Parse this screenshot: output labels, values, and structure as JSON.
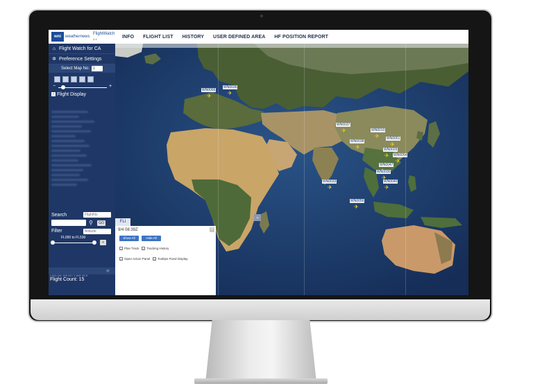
{
  "topbar": {
    "logo_text": "wni",
    "brand": "weathernews",
    "product": "FlightWatch",
    "version": "4.4",
    "nav": [
      "INFO",
      "FLIGHT LIST",
      "HISTORY",
      "USER DEFINED AREA",
      "HF POSITION REPORT"
    ]
  },
  "sidebar": {
    "flight_watch_label": "Flight Watch for CA",
    "preference_label": "Preference Settings",
    "select_map_label": "Select Map No:",
    "select_map_value": "1",
    "flight_display_label": "Flight Display",
    "search_label": "Search",
    "search_type": "FlightNo",
    "go_label": "GO",
    "filter_label": "Filter",
    "filter_type": "Altitude",
    "range_text": "FL000 to FL530",
    "coords_text": "LAT/LON: N/S 53 / 1 W/E 45 E",
    "flight_count_label": "Flight Count:",
    "flight_count_value": "15"
  },
  "panel": {
    "tab_label": "FLI",
    "time": "9/4 08:39Z",
    "show_all": "Show All",
    "hide_all": "Hide All",
    "options": [
      "Plan Track",
      "Tracking History",
      "Open Action Panel",
      "Tooltips Fixed Display"
    ]
  },
  "flights": [
    {
      "label": "WN0066"
    },
    {
      "label": "WN0036"
    },
    {
      "label": "WN0037"
    },
    {
      "label": "WN0010"
    },
    {
      "label": "WN0051"
    },
    {
      "label": "WN0038"
    },
    {
      "label": "WN0029"
    },
    {
      "label": "WN0054"
    },
    {
      "label": "WN0047"
    },
    {
      "label": "WN0030"
    },
    {
      "label": "WN0040"
    },
    {
      "label": "WN0033"
    },
    {
      "label": "WN0056"
    }
  ],
  "colors": {
    "nav_text": "#1f2f4d",
    "sidebar_bg": "#1f3766",
    "plane_icon": "#f5d324",
    "button_blue": "#3d73c4"
  }
}
